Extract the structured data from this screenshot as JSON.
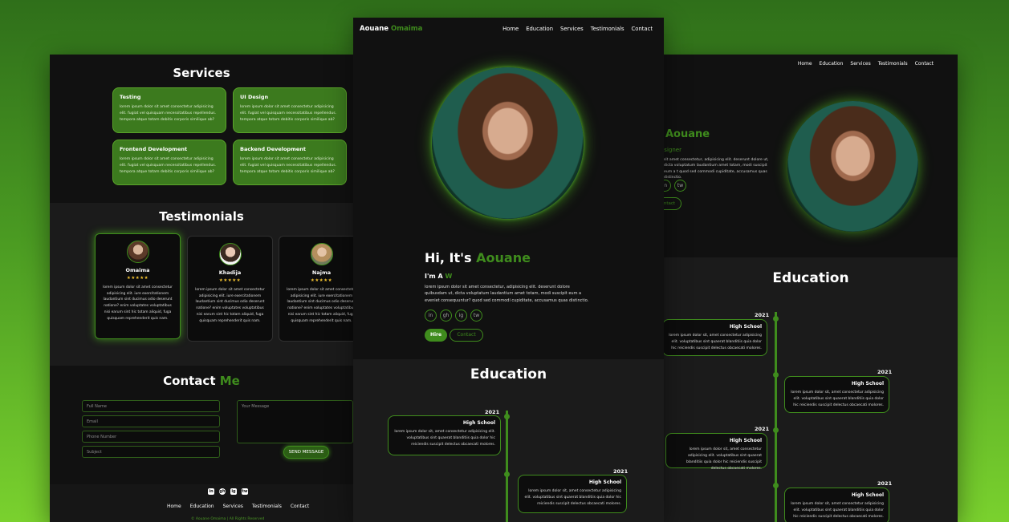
{
  "left": {
    "services_title": "Services",
    "services": [
      {
        "title": "Testing",
        "text": "lorem ipsum dolor sit amet consectetur adipisicing elit. fugiat vel quisquam necessitatibus repellendus. tempora atque totam debitis corporis similique ab?"
      },
      {
        "title": "UI Design",
        "text": "lorem ipsum dolor sit amet consectetur adipisicing elit. fugiat vel quisquam necessitatibus repellendus. tempora atque totam debitis corporis similique ab?"
      },
      {
        "title": "Frontend Development",
        "text": "lorem ipsum dolor sit amet consectetur adipisicing elit. fugiat vel quisquam necessitatibus repellendus. tempora atque totam debitis corporis similique ab?"
      },
      {
        "title": "Backend Development",
        "text": "lorem ipsum dolor sit amet consectetur adipisicing elit. fugiat vel quisquam necessitatibus repellendus. tempora atque totam debitis corporis similique ab?"
      }
    ],
    "testimonials_title": "Testimonials",
    "testimonials": [
      {
        "name": "Omaima",
        "stars": "★★★★★",
        "quote": "lorem ipsum dolor sit amet consectetur adipisicing elit. iure exercitationem laudantium sint ducimus odio deserunt natione? enim voluptates voluptatibus nisi earum sint hic totam aliquid, fuga quisquam reprehenderit quis nam."
      },
      {
        "name": "Khadija",
        "stars": "★★★★★",
        "quote": "lorem ipsum dolor sit amet consectetur adipisicing elit. iure exercitationem laudantium sint ducimus odio deserunt natione? enim voluptates voluptatibus nisi earum sint hic totam aliquid, fuga quisquam reprehenderit quis nam."
      },
      {
        "name": "Najma",
        "stars": "★★★★★",
        "quote": "lorem ipsum dolor sit amet consectetur adipisicing elit. iure exercitationem laudantium sint ducimus odio deserunt natione? enim voluptates voluptatibus nisi earum sint hic totam aliquid, fuga quisquam reprehenderit quis nam."
      }
    ],
    "contact_title": "Contact",
    "contact_accent": "Me",
    "fields": {
      "full_name": "Full Name",
      "email": "Email",
      "phone": "Phone Number",
      "subject": "Subject",
      "message": "Your Message"
    },
    "send_label": "SEND MESSAGE",
    "footer_icons": [
      "in",
      "gh",
      "ig",
      "tw"
    ],
    "footer_nav": [
      "Home",
      "Education",
      "Services",
      "Testimonials",
      "Contact"
    ],
    "copyright": "© Aouane Omaima | All Rights Reserved"
  },
  "center": {
    "logo_first": "Aouane",
    "logo_second": "Omaima",
    "nav": [
      "Home",
      "Education",
      "Services",
      "Testimonials",
      "Contact"
    ],
    "hero_greeting": "Hi, It's",
    "hero_name": "Aouane",
    "role_prefix": "I'm A",
    "role_typed": "W",
    "bio": "lorem ipsum dolor sit amet consectetur, adipisicing elit. deserunt dolore quibusdam ut, dicta voluptatum laudantium amet totam, modi suscipit eum a eveniet consequuntur? quod sed commodi cupiditate, accusamus quas distinctio.",
    "social": [
      "in",
      "gh",
      "ig",
      "tw"
    ],
    "hire_label": "Hire",
    "contact_label": "Contact",
    "education_title": "Education",
    "timeline": [
      {
        "year": "2021",
        "title": "High School",
        "text": "lorem ipsum dolor sit, amet consectetur adipisicing elit. voluptatibus sint quaerat blanditiis quia dolor hic reiciendis suscipit delectus obcaecati molores."
      },
      {
        "year": "2021",
        "title": "High School",
        "text": "lorem ipsum dolor sit, amet consectetur adipisicing elit. voluptatibus sint quaerat blanditiis quia dolor hic reiciendis suscipit delectus obcaecati molores."
      }
    ]
  },
  "right": {
    "nav": [
      "Home",
      "Education",
      "Services",
      "Testimonials",
      "Contact"
    ],
    "name": "Aouane",
    "role": "esigner",
    "bio": "sit amet consectetur, adipisicing elit. deserunt dolore ut, dicta voluptatum laudantium amet totam, modi suscipit eum a t quod sed commodi cupiditate, accusamus quas distinctio.",
    "social": [
      "in",
      "tw"
    ],
    "contact_label": "ntact",
    "education_title": "Education",
    "timeline": [
      {
        "year": "2021",
        "title": "High School",
        "text": "lorem ipsum dolor sit, amet consectetur adipisicing elit. voluptatibus sint quaerat blanditiis quia dolor hic reiciendis suscipit delectus obcaecati molores."
      },
      {
        "year": "2021",
        "title": "High School",
        "text": "lorem ipsum dolor sit, amet consectetur adipisicing elit. voluptatibus sint quaerat blanditiis quia dolor hic reiciendis suscipit delectus obcaecati molores."
      },
      {
        "year": "2021",
        "title": "High School",
        "text": "lorem ipsum dolor sit, amet consectetur adipisicing elit. voluptatibus sint quaerat blanditiis quia dolor hic reiciendis suscipit delectus obcaecati molores."
      },
      {
        "year": "2021",
        "title": "High School",
        "text": "lorem ipsum dolor sit, amet consectetur adipisicing elit. voluptatibus sint quaerat blanditiis quia dolor hic reiciendis suscipit delectus obcaecati molores."
      }
    ]
  },
  "colors": {
    "accent": "#3f8c1d",
    "panel_bg": "#111111",
    "band_bg": "#1b1b1b",
    "star": "#f2c230"
  }
}
